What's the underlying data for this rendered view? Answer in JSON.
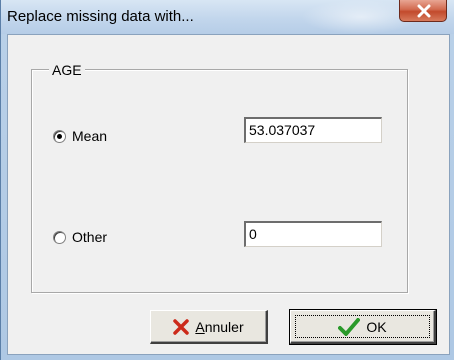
{
  "window": {
    "title": "Replace missing data with..."
  },
  "group": {
    "label": "AGE"
  },
  "options": [
    {
      "label": "Mean",
      "selected": true,
      "value": "53.037037"
    },
    {
      "label": "Other",
      "selected": false,
      "value": "0"
    }
  ],
  "buttons": {
    "cancel_label": "Annuler",
    "ok_label": "OK"
  },
  "colors": {
    "cancel_icon": "#cc2a1a",
    "ok_icon": "#2a9a2a",
    "close_button": "#c9503a"
  },
  "icons": {
    "cancel": "x-icon",
    "ok": "checkmark-icon",
    "close": "close-icon"
  }
}
